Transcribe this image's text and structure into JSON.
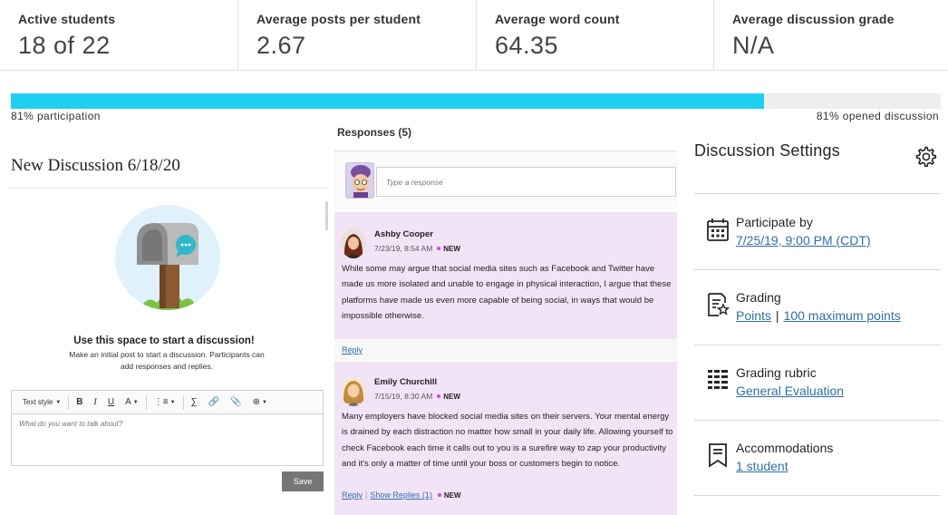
{
  "stats": [
    {
      "label": "Active students",
      "value": "18 of 22"
    },
    {
      "label": "Average posts per student",
      "value": "2.67"
    },
    {
      "label": "Average word count",
      "value": "64.35"
    },
    {
      "label": "Average discussion grade",
      "value": "N/A"
    }
  ],
  "participation": {
    "percent": 81,
    "left_label": "81% participation",
    "right_label": "81% opened discussion",
    "bar_color": "#1fd0f2"
  },
  "discussion": {
    "title": "New Discussion 6/18/20",
    "prompt_title": "Use this space to start a discussion!",
    "prompt_subtitle": "Make an initial post to start a discussion. Participants can add responses and replies.",
    "toolbar": {
      "text_style": "Text style",
      "icons": [
        "bold-icon",
        "italic-icon",
        "underline-icon",
        "text-color-icon",
        "list-icon",
        "formula-icon",
        "link-icon",
        "attachment-icon",
        "insert-icon"
      ]
    },
    "editor_placeholder": "What do you want to talk about?",
    "save_label": "Save"
  },
  "responses": {
    "header": "Responses (5)",
    "input_placeholder": "Type a response",
    "posts": [
      {
        "author": "Ashby Cooper",
        "time": "7/23/19, 8:54 AM",
        "badge": "NEW",
        "body": "While some may argue that social media sites such as Facebook and Twitter have made us more isolated and unable to engage in physical interaction, I argue that these platforms have made us even more capable of being social, in ways that would be impossible otherwise.",
        "reply_label": "Reply"
      },
      {
        "author": "Emily Churchill",
        "time": "7/15/19, 8:30 AM",
        "badge": "NEW",
        "body": "Many employers have blocked social media sites on their servers. Your mental energy is drained by each distraction no matter how small in your daily life. Allowing yourself to check Facebook each time it calls out to you is a surefire way to zap your productivity and it's only a matter of time until your boss or customers begin to notice.",
        "reply_label": "Reply",
        "show_replies_label": "Show Replies (1)",
        "replies_badge": "NEW"
      }
    ]
  },
  "settings": {
    "title": "Discussion Settings",
    "participate": {
      "label": "Participate by",
      "value": "7/25/19, 9:00 PM (CDT)"
    },
    "grading": {
      "label": "Grading",
      "type": "Points",
      "separator": "|",
      "max": "100 maximum points"
    },
    "rubric": {
      "label": "Grading rubric",
      "value": "General Evaluation"
    },
    "accommodations": {
      "label": "Accommodations",
      "value": "1 student"
    }
  }
}
